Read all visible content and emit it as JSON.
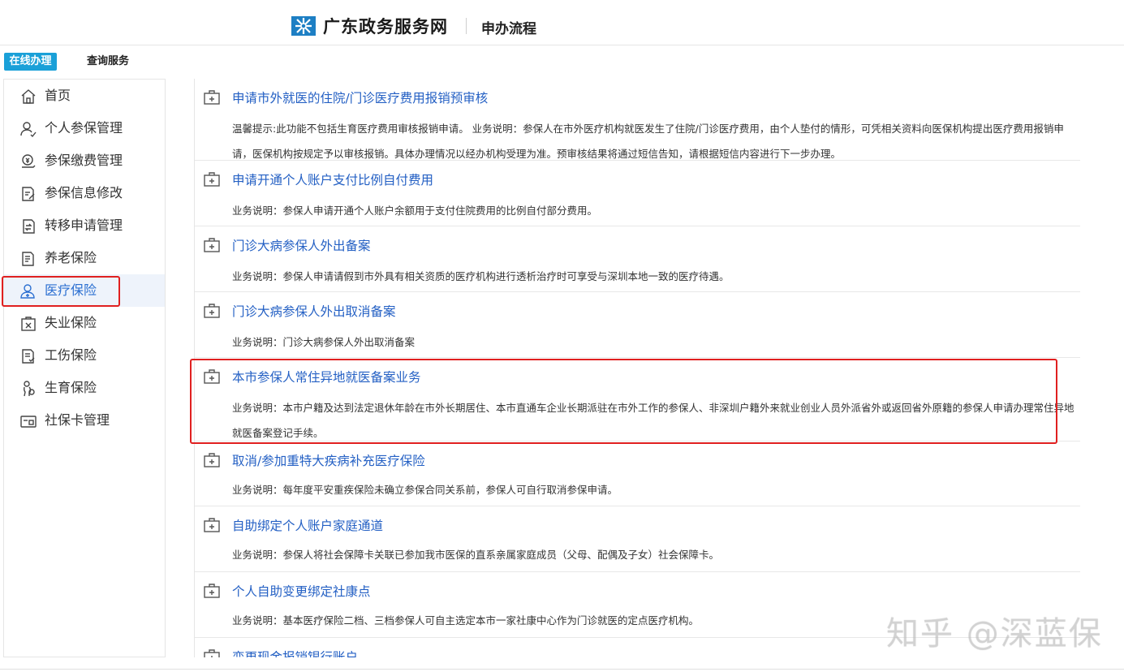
{
  "header": {
    "site_name": "广东政务服务网",
    "section": "申办流程"
  },
  "tabs": [
    {
      "label": "在线办理",
      "active": true
    },
    {
      "label": "查询服务",
      "active": false
    }
  ],
  "sidebar": {
    "items": [
      {
        "label": "首页",
        "icon": "home-icon"
      },
      {
        "label": "个人参保管理",
        "icon": "user-manage-icon"
      },
      {
        "label": "参保缴费管理",
        "icon": "payment-icon"
      },
      {
        "label": "参保信息修改",
        "icon": "edit-doc-icon"
      },
      {
        "label": "转移申请管理",
        "icon": "transfer-doc-icon"
      },
      {
        "label": "养老保险",
        "icon": "pension-doc-icon"
      },
      {
        "label": "医疗保险",
        "icon": "medical-user-icon",
        "active": true
      },
      {
        "label": "失业保险",
        "icon": "unemployment-icon"
      },
      {
        "label": "工伤保险",
        "icon": "injury-doc-icon"
      },
      {
        "label": "生育保险",
        "icon": "maternity-icon"
      },
      {
        "label": "社保卡管理",
        "icon": "card-icon"
      }
    ]
  },
  "services": [
    {
      "title": "申请市外就医的住院/门诊医疗费用报销预审核",
      "desc": "温馨提示:此功能不包括生育医疗费用审核报销申请。 业务说明：参保人在市外医疗机构就医发生了住院/门诊医疗费用，由个人垫付的情形，可凭相关资料向医保机构提出医疗费用报销申请，医保机构按规定予以审核报销。具体办理情况以经办机构受理为准。预审核结果将通过短信告知，请根据短信内容进行下一步办理。"
    },
    {
      "title": "申请开通个人账户支付比例自付费用",
      "desc": "业务说明：参保人申请开通个人账户余额用于支付住院费用的比例自付部分费用。"
    },
    {
      "title": "门诊大病参保人外出备案",
      "desc": "业务说明：参保人申请请假到市外具有相关资质的医疗机构进行透析治疗时可享受与深圳本地一致的医疗待遇。"
    },
    {
      "title": "门诊大病参保人外出取消备案",
      "desc": "业务说明：门诊大病参保人外出取消备案"
    },
    {
      "title": "本市参保人常住异地就医备案业务",
      "desc": "业务说明：本市户籍及达到法定退休年龄在市外长期居住、本市直通车企业长期派驻在市外工作的参保人、非深圳户籍外来就业创业人员外派省外或返回省外原籍的参保人申请办理常住异地就医备案登记手续。"
    },
    {
      "title": "取消/参加重特大疾病补充医疗保险",
      "desc": "业务说明：每年度平安重疾保险未确立参保合同关系前，参保人可自行取消参保申请。"
    },
    {
      "title": "自助绑定个人账户家庭通道",
      "desc": "业务说明：参保人将社会保障卡关联已参加我市医保的直系亲属家庭成员（父母、配偶及子女）社会保障卡。"
    },
    {
      "title": "个人自助变更绑定社康点",
      "desc": "业务说明：基本医疗保险二档、三档参保人可自主选定本市一家社康中心作为门诊就医的定点医疗机构。"
    },
    {
      "title": "变更现金报销银行账户",
      "desc": ""
    }
  ],
  "watermark": "知乎 @深蓝保",
  "colors": {
    "accent": "#1aa0d8",
    "link": "#2460c4",
    "highlight": "#e02020"
  }
}
